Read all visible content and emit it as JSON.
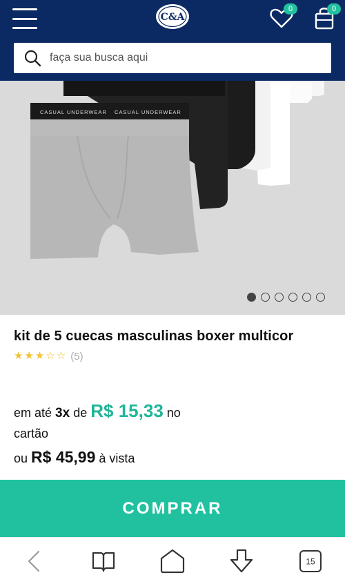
{
  "header": {
    "logo": "C&A",
    "wishlist_count": "0",
    "cart_count": "0"
  },
  "search": {
    "placeholder": "faça sua busca aqui"
  },
  "hero": {
    "waistband_text": "CASUAL UNDERWEAR",
    "slides": 6,
    "active_slide": 1
  },
  "product": {
    "title": "kit de 5 cuecas masculinas boxer multicor",
    "rating_stars": 3,
    "rating_max": 5,
    "rating_count": "(5)"
  },
  "pricing": {
    "prefix": "em até",
    "installments": "3x",
    "of": "de",
    "installment_price": "R$ 15,33",
    "suffix_a": "no",
    "suffix_b": "cartão",
    "or": "ou",
    "cash_price": "R$ 45,99",
    "cash_suffix": "à vista"
  },
  "actions": {
    "buy_label": "COMPRAR"
  },
  "browser_nav": {
    "tab_count": "15"
  },
  "colors": {
    "header_bg": "#0b2a63",
    "accent": "#21c1a0",
    "price": "#21b598",
    "star": "#f2c230"
  }
}
